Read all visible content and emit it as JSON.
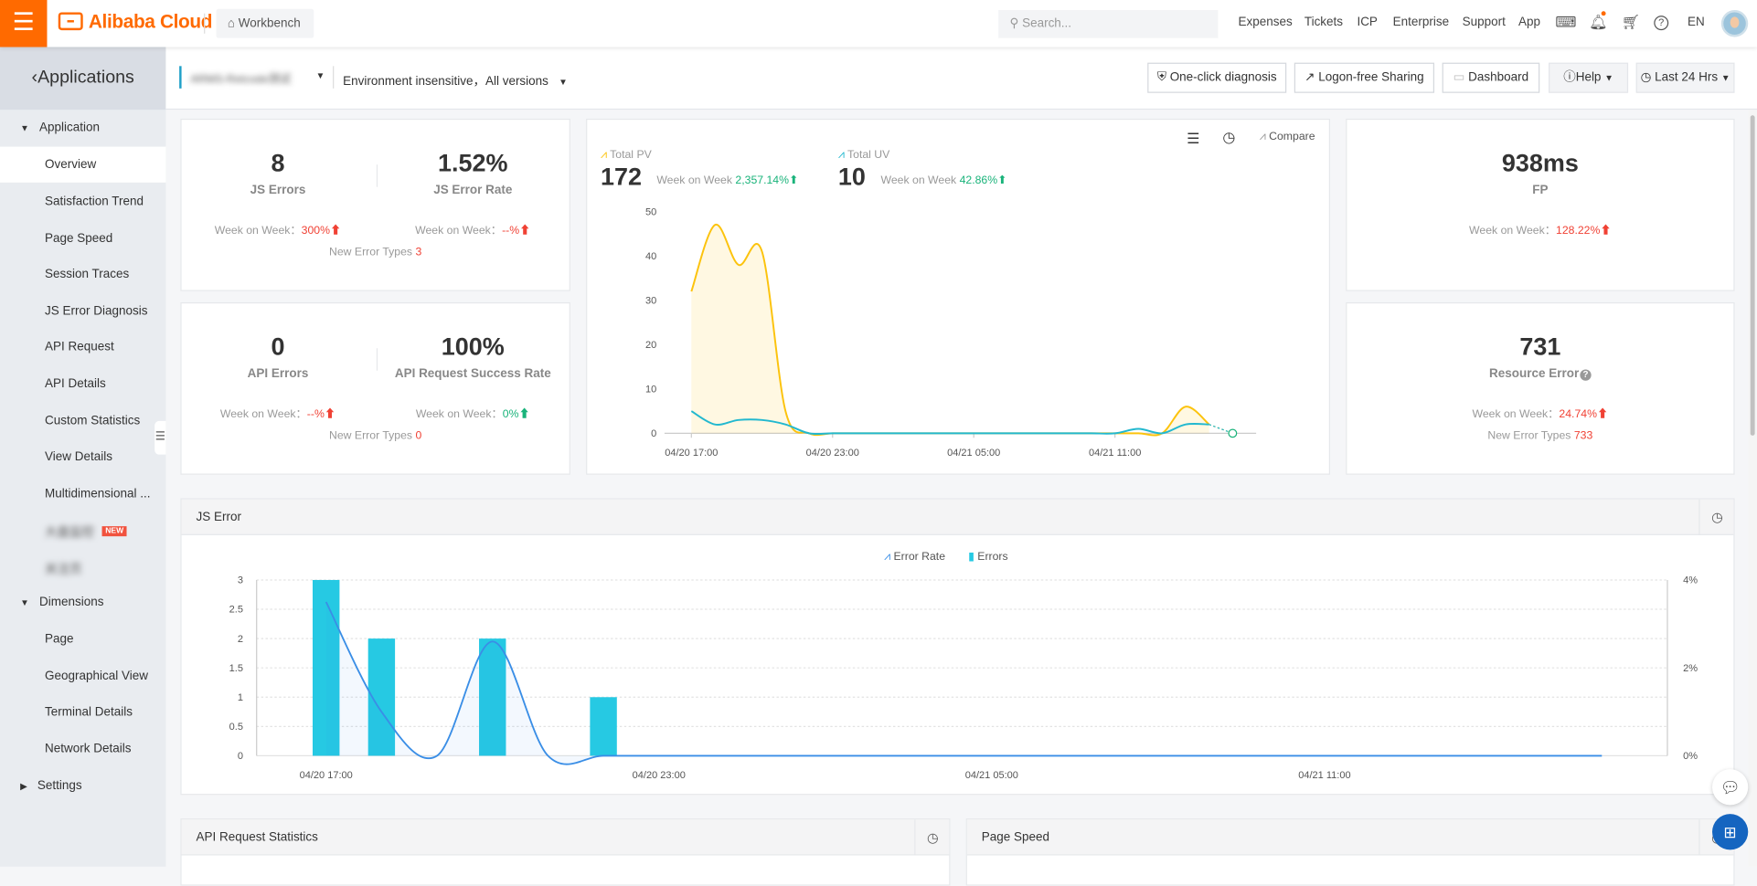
{
  "topbar": {
    "brand": "Alibaba Cloud",
    "workbench": "Workbench",
    "search_placeholder": "Search...",
    "links": [
      "Expenses",
      "Tickets",
      "ICP",
      "Enterprise",
      "Support",
      "App"
    ],
    "lang": "EN"
  },
  "sidebar": {
    "title": "Applications",
    "groups": [
      {
        "label": "Application",
        "items": [
          "Overview",
          "Satisfaction Trend",
          "Page Speed",
          "Session Traces",
          "JS Error Diagnosis",
          "API Request",
          "API Details",
          "Custom Statistics",
          "View Details",
          "Multidimensional ...",
          "大盘监控",
          "关注页"
        ]
      },
      {
        "label": "Dimensions",
        "items": [
          "Page",
          "Geographical View",
          "Terminal Details",
          "Network Details"
        ]
      },
      {
        "label": "Settings",
        "items": []
      }
    ],
    "new_badge": "NEW",
    "active": "Overview"
  },
  "subbar": {
    "app_name": "ARMS-Retcode测试",
    "env": "Environment insensitive，All versions",
    "buttons": {
      "diagnosis": "One-click diagnosis",
      "sharing": "Logon-free Sharing",
      "dashboard": "Dashboard",
      "help": "Help",
      "time": "Last 24 Hrs"
    }
  },
  "kpi": {
    "js_errors": {
      "value": "8",
      "label": "JS Errors",
      "wow_label": "Week on Week：",
      "wow": "300%"
    },
    "js_error_rate": {
      "value": "1.52%",
      "label": "JS Error Rate",
      "wow_label": "Week on Week：",
      "wow": "--%"
    },
    "js_new_types_label": "New Error Types",
    "js_new_types": "3",
    "api_errors": {
      "value": "0",
      "label": "API Errors",
      "wow_label": "Week on Week：",
      "wow": "--%"
    },
    "api_success": {
      "value": "100%",
      "label": "API Request Success Rate",
      "wow_label": "Week on Week：",
      "wow": "0%"
    },
    "api_new_types_label": "New Error Types",
    "api_new_types": "0",
    "fp": {
      "value": "938ms",
      "label": "FP",
      "wow_label": "Week on Week：",
      "wow": "128.22%"
    },
    "resource": {
      "value": "731",
      "label": "Resource Error",
      "wow_label": "Week on Week：",
      "wow": "24.74%",
      "new_types_label": "New Error Types",
      "new_types": "733"
    }
  },
  "pv_panel": {
    "compare": "Compare",
    "pv_label": "Total PV",
    "pv": "172",
    "pv_wow_label": "Week on Week",
    "pv_wow": "2,357.14%",
    "uv_label": "Total UV",
    "uv": "10",
    "uv_wow_label": "Week on Week",
    "uv_wow": "42.86%"
  },
  "js_panel": {
    "title": "JS Error",
    "legend": [
      "Error Rate",
      "Errors"
    ]
  },
  "bottom": {
    "api_title": "API Request Statistics",
    "speed_title": "Page Speed"
  },
  "colors": {
    "brand": "#ff6a00",
    "pv": "#fcc30d",
    "uv": "#22b8cf",
    "bars": "#26c9e3",
    "rate": "#3a8ee6",
    "up_red": "#f04134",
    "up_green": "#19b37a"
  },
  "chart_data": [
    {
      "type": "line",
      "series": [
        {
          "name": "Total PV",
          "values": [
            32,
            47,
            38,
            41,
            5,
            0,
            0,
            0,
            0,
            0,
            0,
            0,
            0,
            0,
            0,
            0,
            0,
            0,
            0,
            0,
            0,
            6,
            2,
            0
          ]
        },
        {
          "name": "Total UV",
          "values": [
            5,
            2,
            3,
            3,
            2,
            0,
            0,
            0,
            0,
            0,
            0,
            0,
            0,
            0,
            0,
            0,
            0,
            0,
            0,
            1,
            0,
            2,
            2,
            0
          ]
        }
      ],
      "x_ticks": [
        "04/20 17:00",
        "04/20 23:00",
        "04/21 05:00",
        "04/21 11:00"
      ],
      "y_ticks": [
        0,
        10,
        20,
        30,
        40,
        50
      ],
      "ylim": [
        0,
        50
      ]
    },
    {
      "type": "bar",
      "series": [
        {
          "name": "Errors",
          "values": [
            3,
            2,
            0,
            2,
            0,
            1,
            0,
            0,
            0,
            0,
            0,
            0,
            0,
            0,
            0,
            0,
            0,
            0,
            0,
            0,
            0,
            0,
            0,
            0
          ]
        },
        {
          "name": "Error Rate",
          "values": [
            3.5,
            1,
            0,
            2.6,
            0,
            0,
            0,
            0,
            0,
            0,
            0,
            0,
            0,
            0,
            0,
            0,
            0,
            0,
            0,
            0,
            0,
            0,
            0,
            0
          ]
        }
      ],
      "x_ticks": [
        "04/20 17:00",
        "04/20 23:00",
        "04/21 05:00",
        "04/21 11:00"
      ],
      "y_ticks": [
        "0",
        "0.5",
        "1",
        "1.5",
        "2",
        "2.5",
        "3"
      ],
      "y2_ticks": [
        "0%",
        "2%",
        "4%"
      ],
      "ylim": [
        0,
        3
      ],
      "y2lim": [
        0,
        4
      ]
    }
  ]
}
